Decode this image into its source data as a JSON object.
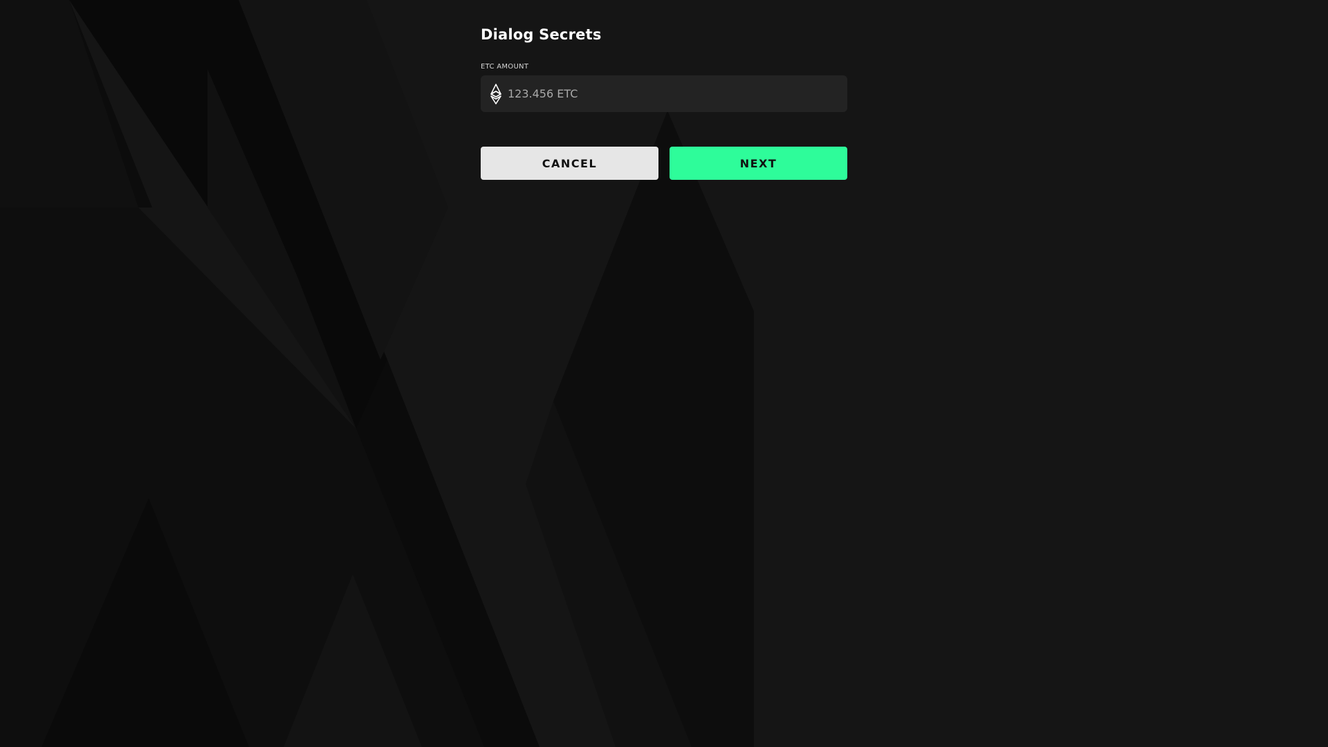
{
  "dialog": {
    "title": "Dialog Secrets",
    "amount_label": "ETC AMOUNT",
    "amount_placeholder": "123.456 ETC",
    "amount_icon": "ethereum-classic-icon",
    "cancel_label": "CANCEL",
    "next_label": "NEXT"
  },
  "colors": {
    "accent": "#2efc9a",
    "background": "#151515",
    "field_background": "#232323",
    "cancel_background": "#e6e6e6"
  }
}
